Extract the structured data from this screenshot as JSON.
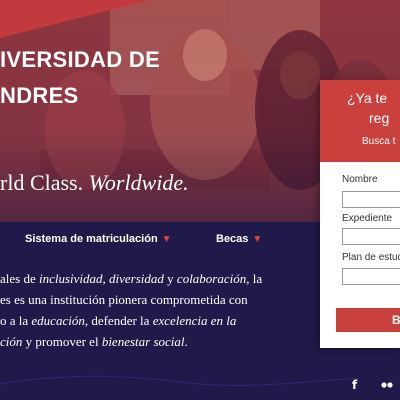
{
  "hero": {
    "title_line1": "IVERSIDAD DE",
    "title_line2": "NDRES",
    "tagline_part1": "rld Class. ",
    "tagline_part2": "Worldwide."
  },
  "nav": {
    "items": [
      {
        "label": "Sistema de matriculación"
      },
      {
        "label": "Becas"
      }
    ]
  },
  "intro": {
    "lines": [
      [
        {
          "t": "ales de ",
          "i": false
        },
        {
          "t": "inclusividad, diversidad",
          "i": true
        },
        {
          "t": " y ",
          "i": false
        },
        {
          "t": "colaboración",
          "i": true
        },
        {
          "t": ", la",
          "i": false
        }
      ],
      [
        {
          "t": "es es una institución pionera comprometida con",
          "i": false
        }
      ],
      [
        {
          "t": "o a la ",
          "i": false
        },
        {
          "t": "educación",
          "i": true
        },
        {
          "t": ", defender la ",
          "i": false
        },
        {
          "t": "excelencia en la",
          "i": true
        }
      ],
      [
        {
          "t": "ción",
          "i": true
        },
        {
          "t": " y promover el ",
          "i": false
        },
        {
          "t": "bienestar social",
          "i": true
        },
        {
          "t": ".",
          "i": false
        }
      ]
    ]
  },
  "form": {
    "heading_line1": "¿Ya te",
    "heading_line2": "reg",
    "subheading": "Busca t",
    "fields": [
      {
        "label": "Nombre",
        "value": ""
      },
      {
        "label": "Expediente",
        "value": ""
      },
      {
        "label": "Plan de estud",
        "value": ""
      }
    ],
    "submit_label": "B"
  },
  "footer": {
    "icons": [
      "facebook-icon",
      "flickr-icon"
    ]
  },
  "colors": {
    "accent_red": "#c9403d",
    "navy": "#1f1a4a",
    "nav_caret": "#e0463c"
  }
}
